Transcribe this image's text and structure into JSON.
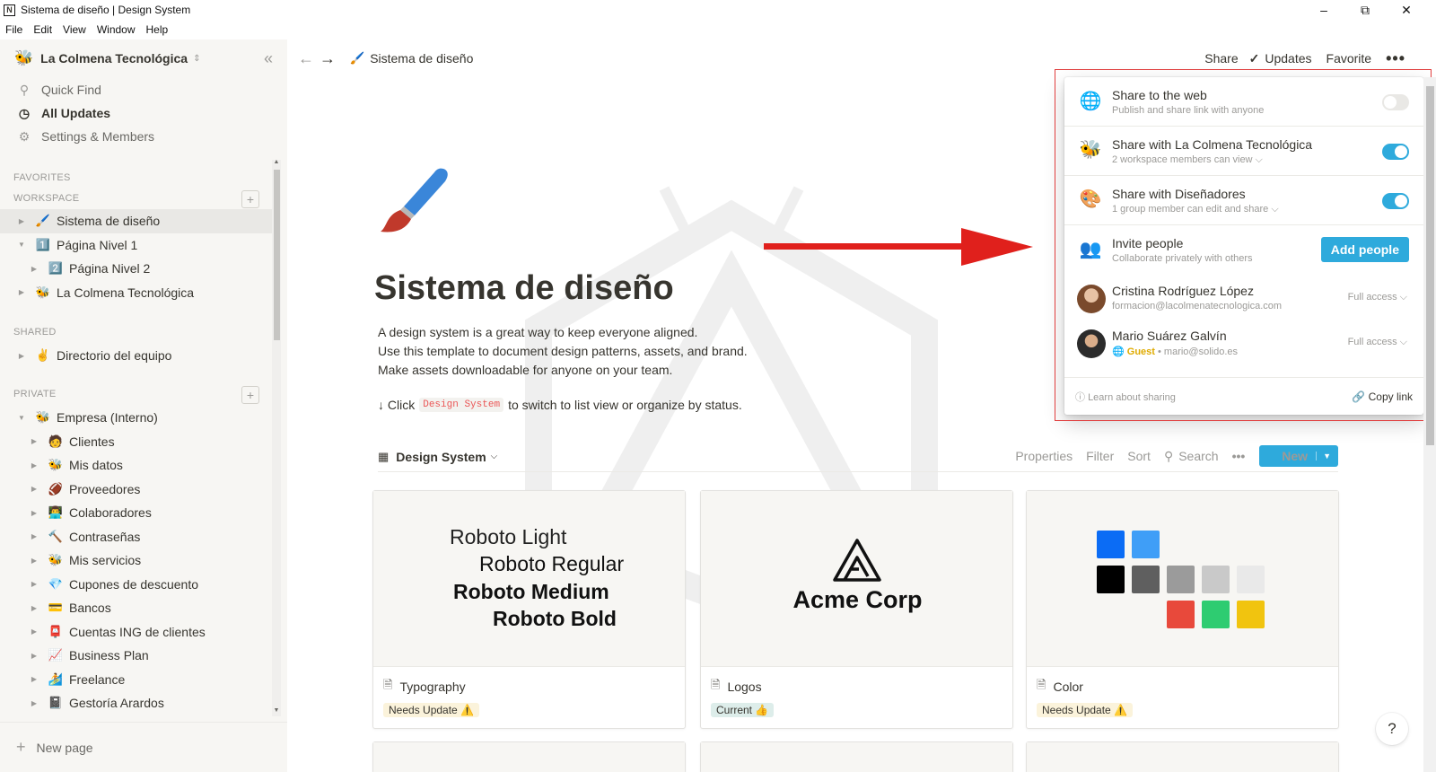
{
  "window": {
    "title": "Sistema de diseño | Design System",
    "app_icon": "N",
    "menus": [
      "File",
      "Edit",
      "View",
      "Window",
      "Help"
    ]
  },
  "sidebar": {
    "workspace": "La Colmena Tecnológica",
    "nav": [
      {
        "label": "Quick Find",
        "icon": "search-icon"
      },
      {
        "label": "All Updates",
        "icon": "clock-icon"
      },
      {
        "label": "Settings & Members",
        "icon": "gear-icon"
      }
    ],
    "sections": {
      "favorites": "FAVORITES",
      "workspace": "WORKSPACE",
      "shared": "SHARED",
      "private": "PRIVATE"
    },
    "workspace_pages": [
      {
        "label": "Sistema de diseño",
        "emoji": "🖌️"
      },
      {
        "label": "Página Nivel 1",
        "emoji": "1️⃣"
      },
      {
        "label": "Página Nivel 2",
        "emoji": "2️⃣"
      },
      {
        "label": "La Colmena Tecnológica",
        "emoji": "🐝"
      }
    ],
    "shared_pages": [
      {
        "label": "Directorio del equipo",
        "emoji": "✌️"
      }
    ],
    "private_pages": [
      {
        "label": "Empresa (Interno)",
        "emoji": "🐝"
      },
      {
        "label": "Clientes",
        "emoji": "🧑"
      },
      {
        "label": "Mis datos",
        "emoji": "🐝"
      },
      {
        "label": "Proveedores",
        "emoji": "🏈"
      },
      {
        "label": "Colaboradores",
        "emoji": "👨‍💻"
      },
      {
        "label": "Contraseñas",
        "emoji": "🔨"
      },
      {
        "label": "Mis servicios",
        "emoji": "🐝"
      },
      {
        "label": "Cupones de descuento",
        "emoji": "💎"
      },
      {
        "label": "Bancos",
        "emoji": "💳"
      },
      {
        "label": "Cuentas ING de clientes",
        "emoji": "📮"
      },
      {
        "label": "Business Plan",
        "emoji": "📈"
      },
      {
        "label": "Freelance",
        "emoji": "🏄"
      },
      {
        "label": "Gestoría Arardos",
        "emoji": "📓"
      }
    ],
    "new_page": "New page"
  },
  "topbar": {
    "breadcrumb": "Sistema de diseño",
    "share": "Share",
    "updates": "Updates",
    "favorite": "Favorite",
    "more": "•••"
  },
  "page": {
    "title": "Sistema de diseño",
    "description": [
      "A design system is a great way to keep everyone aligned.",
      "Use this template to document design patterns, assets, and brand.",
      "Make assets downloadable for anyone on your team."
    ],
    "hint_prefix": "↓ Click",
    "hint_code": "Design System",
    "hint_suffix": "to switch to list view or organize by status."
  },
  "database": {
    "name": "Design System",
    "tools": [
      "Properties",
      "Filter",
      "Sort",
      "Search",
      "•••"
    ],
    "new_label": "New",
    "cards": [
      {
        "title": "Typography",
        "status": "Needs Update ⚠️",
        "fonts": [
          "Roboto Light",
          "Roboto Regular",
          "Roboto Medium",
          "Roboto Bold"
        ]
      },
      {
        "title": "Logos",
        "status": "Current 👍",
        "logo_text": "Acme Corp"
      },
      {
        "title": "Color",
        "status": "Needs Update ⚠️",
        "swatches": [
          "#0b6cf5",
          "#3f9ef7",
          "#000000",
          "#5f5f5f",
          "#9b9b9b",
          "#c9c9c9",
          "#e9e9e9",
          "#e8493b",
          "#2ecc71",
          "#f1c40f"
        ]
      }
    ]
  },
  "share_popup": {
    "web": {
      "title": "Share to the web",
      "subtitle": "Publish and share link with anyone",
      "enabled": false
    },
    "workspace": {
      "title": "Share with La Colmena Tecnológica",
      "subtitle": "2 workspace members can view ⌵",
      "enabled": true
    },
    "group": {
      "title": "Share with Diseñadores",
      "subtitle": "1 group member can edit and share ⌵",
      "enabled": true
    },
    "invite": {
      "title": "Invite people",
      "subtitle": "Collaborate privately with others",
      "button": "Add people"
    },
    "people": [
      {
        "name": "Cristina Rodríguez López",
        "email": "formacion@lacolmenatecnologica.com",
        "access": "Full access ⌵"
      },
      {
        "name": "Mario Suárez Galvín",
        "guest": "Guest",
        "email": "• mario@solido.es",
        "access": "Full access ⌵"
      }
    ],
    "learn": "Learn about sharing",
    "copy_link": "Copy link"
  },
  "help": "?",
  "colors": {
    "accent": "#2eaadc",
    "highlight": "#e03e3e",
    "arrow": "#e0201c"
  }
}
